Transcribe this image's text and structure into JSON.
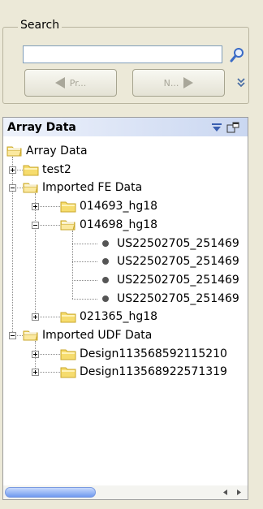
{
  "search": {
    "legend": "Search",
    "value": "",
    "prev_label": "Pr...",
    "next_label": "N..."
  },
  "panel": {
    "title": "Array Data"
  },
  "tree": [
    {
      "label": "Array Data",
      "level": 0,
      "kind": "folder-open"
    },
    {
      "label": "test2",
      "level": 1,
      "kind": "folder",
      "expander": "plus"
    },
    {
      "label": "Imported FE Data",
      "level": 1,
      "kind": "folder-open",
      "expander": "minus"
    },
    {
      "label": "014693_hg18",
      "level": 2,
      "kind": "folder",
      "expander": "plus"
    },
    {
      "label": "014698_hg18",
      "level": 2,
      "kind": "folder-open",
      "expander": "minus"
    },
    {
      "label": "US22502705_251469",
      "level": 3,
      "kind": "item"
    },
    {
      "label": "US22502705_251469",
      "level": 3,
      "kind": "item"
    },
    {
      "label": "US22502705_251469",
      "level": 3,
      "kind": "item"
    },
    {
      "label": "US22502705_251469",
      "level": 3,
      "kind": "item"
    },
    {
      "label": "021365_hg18",
      "level": 2,
      "kind": "folder",
      "expander": "plus"
    },
    {
      "label": "Imported UDF Data",
      "level": 1,
      "kind": "folder-open",
      "expander": "minus"
    },
    {
      "label": "Design113568592115210",
      "level": 2,
      "kind": "folder",
      "expander": "plus"
    },
    {
      "label": "Design113568922571319",
      "level": 2,
      "kind": "folder",
      "expander": "plus"
    }
  ],
  "colors": {
    "folder_fill": "#f6dc6e",
    "folder_edge": "#c9a72b",
    "header_gradient_end": "#cad7f1",
    "scroll_thumb": "#6f99ef"
  },
  "icons": {
    "search": "magnifier-icon",
    "more": "double-chevron-down-icon",
    "pin": "pin-down-icon",
    "float": "float-window-icon"
  }
}
